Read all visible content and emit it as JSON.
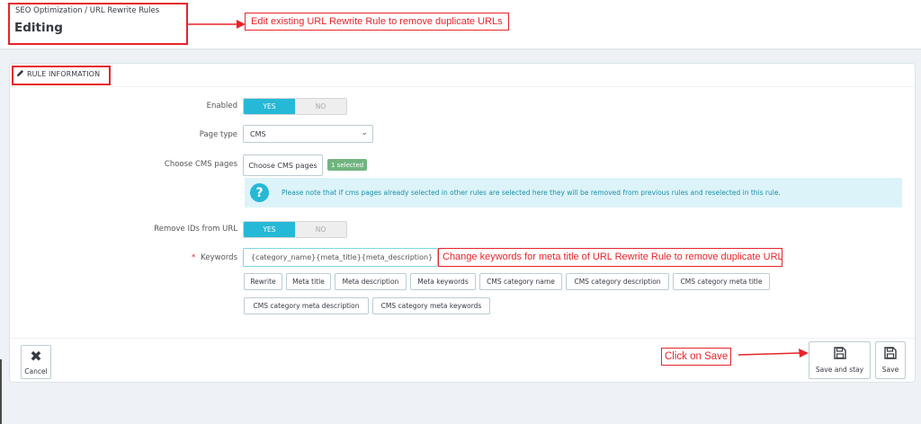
{
  "header": {
    "breadcrumb": "SEO Optimization  /  URL Rewrite Rules",
    "title": "Editing"
  },
  "annotations": {
    "edit_note": "Edit existing URL Rewrite Rule to remove duplicate URLs",
    "keywords_note": "Change keywords for meta title of URL Rewrite Rule to remove duplicate URLs",
    "save_note": "Click on Save",
    "color": "#e8232a"
  },
  "panel": {
    "heading": "RULE INFORMATION",
    "heading_icon": "pencil-icon"
  },
  "form": {
    "enabled_label": "Enabled",
    "enabled_yes": "YES",
    "enabled_no": "NO",
    "page_type_label": "Page type",
    "page_type_value": "CMS",
    "choose_cms_label": "Choose CMS pages",
    "choose_cms_button": "Choose CMS pages",
    "selected_badge": "1 selected",
    "alert_text": "Please note that if cms pages already selected in other rules are selected here they will be removed from previous rules and reselected in this rule.",
    "remove_ids_label": "Remove IDs from URL",
    "remove_ids_yes": "YES",
    "remove_ids_no": "NO",
    "keywords_required": "*",
    "keywords_label": "Keywords",
    "keywords_value": "{category_name}{meta_title}{meta_description}",
    "tokens": [
      "Rewrite",
      "Meta title",
      "Meta description",
      "Meta keywords",
      "CMS category name",
      "CMS category description",
      "CMS category meta title",
      "CMS category meta description",
      "CMS category meta keywords"
    ]
  },
  "footer": {
    "cancel_label": "Cancel",
    "save_stay_label": "Save and stay",
    "save_label": "Save"
  },
  "colors": {
    "accent": "#25b9d7",
    "success": "#70b580",
    "alert_bg": "#dcf4f9"
  }
}
